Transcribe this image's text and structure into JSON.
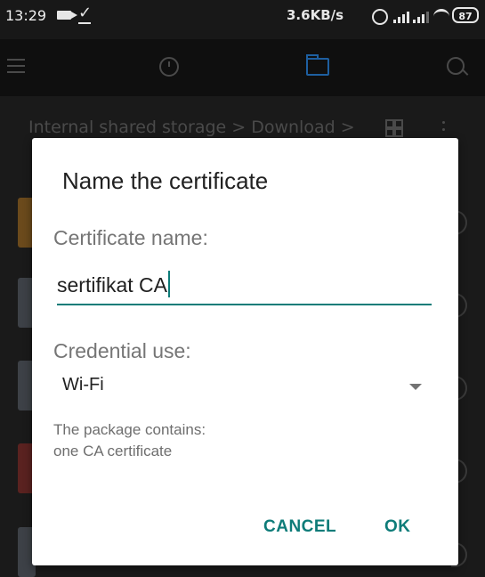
{
  "status_bar": {
    "time": "13:29",
    "network_speed": "3.6KB/s",
    "battery_level": "87",
    "icons": [
      "video-icon",
      "download-done-icon",
      "alarm-icon",
      "signal-icon",
      "signal-icon",
      "wifi-icon",
      "battery-icon"
    ]
  },
  "toolbar": {
    "icons": [
      "menu-icon",
      "clock-icon",
      "folder-icon",
      "search-icon"
    ],
    "accent": "#1e5fa0"
  },
  "breadcrumb": {
    "path": "Internal shared storage > Download >"
  },
  "dialog": {
    "title": "Name the certificate",
    "name_label": "Certificate name:",
    "name_value": "sertifikat CA",
    "credential_label": "Credential use:",
    "credential_value": "Wi-Fi",
    "info_line1": "The package contains:",
    "info_line2": "one CA certificate",
    "cancel_label": "CANCEL",
    "ok_label": "OK",
    "accent_color": "#0e7c79"
  }
}
